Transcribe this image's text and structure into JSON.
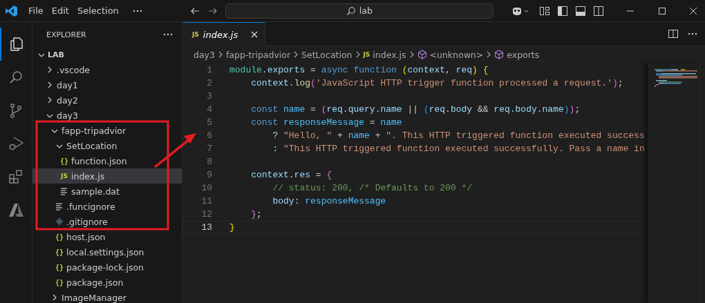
{
  "title_bar": {
    "menu": [
      "File",
      "Edit",
      "Selection"
    ],
    "search": {
      "value": "lab"
    }
  },
  "activity_bar": {
    "items": [
      {
        "kind": "explorer",
        "selected": true
      },
      {
        "kind": "search",
        "selected": false
      },
      {
        "kind": "source-control",
        "selected": false
      },
      {
        "kind": "run-debug",
        "selected": false
      },
      {
        "kind": "extensions",
        "selected": false
      },
      {
        "kind": "azure",
        "selected": false
      }
    ]
  },
  "sidebar": {
    "title": "EXPLORER",
    "root": {
      "label": "LAB",
      "expanded": true,
      "children": [
        {
          "label": ".vscode",
          "kind": "folder",
          "expanded": false,
          "selected": false
        },
        {
          "label": "day1",
          "kind": "folder",
          "expanded": false,
          "selected": false
        },
        {
          "label": "day2",
          "kind": "folder",
          "expanded": false,
          "selected": false
        },
        {
          "label": "day3",
          "kind": "folder",
          "expanded": true,
          "selected": false,
          "children": [
            {
              "label": "fapp-tripadvior",
              "kind": "folder",
              "expanded": true,
              "selected": false,
              "children": [
                {
                  "label": "SetLocation",
                  "kind": "folder",
                  "expanded": true,
                  "selected": false,
                  "children": [
                    {
                      "label": "function.json",
                      "kind": "json",
                      "icon": "{}",
                      "selected": false
                    },
                    {
                      "label": "index.js",
                      "kind": "js",
                      "icon": "JS",
                      "selected": true
                    },
                    {
                      "label": "sample.dat",
                      "kind": "text",
                      "selected": false
                    }
                  ]
                },
                {
                  "label": ".funcignore",
                  "kind": "text",
                  "selected": false
                },
                {
                  "label": ".gitignore",
                  "kind": "git",
                  "selected": false
                },
                {
                  "label": "host.json",
                  "kind": "json",
                  "icon": "{}",
                  "selected": false
                },
                {
                  "label": "local.settings.json",
                  "kind": "json",
                  "icon": "{}",
                  "selected": false
                },
                {
                  "label": "package-lock.json",
                  "kind": "json",
                  "icon": "{}",
                  "selected": false
                },
                {
                  "label": "package.json",
                  "kind": "json",
                  "icon": "{}",
                  "selected": false
                }
              ]
            },
            {
              "label": "ImageManager",
              "kind": "folder",
              "expanded": false,
              "selected": false
            }
          ]
        }
      ]
    }
  },
  "editor": {
    "tabs": [
      {
        "label": "index.js",
        "icon": "JS",
        "selected": true,
        "preview": true
      }
    ],
    "breadcrumbs": [
      {
        "label": "day3",
        "kind": "folder"
      },
      {
        "label": "fapp-tripadvior",
        "kind": "folder"
      },
      {
        "label": "SetLocation",
        "kind": "folder"
      },
      {
        "label": "index.js",
        "kind": "js",
        "icon": "JS"
      },
      {
        "label": "<unknown>",
        "kind": "symbol"
      },
      {
        "label": "exports",
        "kind": "symbol"
      }
    ],
    "lines": [
      {
        "number": "1",
        "current": false,
        "tokens": [
          {
            "text": "module",
            "kind": "ns"
          },
          {
            "text": ".",
            "kind": "p"
          },
          {
            "text": "exports",
            "kind": "var"
          },
          {
            "text": " = ",
            "kind": "p"
          },
          {
            "text": "async ",
            "kind": "kw"
          },
          {
            "text": "function ",
            "kind": "kw"
          },
          {
            "text": "(",
            "kind": "b1"
          },
          {
            "text": "context",
            "kind": "var"
          },
          {
            "text": ", ",
            "kind": "p"
          },
          {
            "text": "req",
            "kind": "var"
          },
          {
            "text": ") ",
            "kind": "b1"
          },
          {
            "text": "{",
            "kind": "b1"
          }
        ]
      },
      {
        "number": "2",
        "current": false,
        "tokens": [
          {
            "text": "    context",
            "kind": "var"
          },
          {
            "text": ".",
            "kind": "p"
          },
          {
            "text": "log",
            "kind": "fn"
          },
          {
            "text": "(",
            "kind": "b2"
          },
          {
            "text": "'JavaScript HTTP trigger function processed a request.'",
            "kind": "str"
          },
          {
            "text": ")",
            "kind": "b2"
          },
          {
            "text": ";",
            "kind": "p"
          }
        ]
      },
      {
        "number": "3",
        "current": false
      },
      {
        "number": "4",
        "current": false,
        "tokens": [
          {
            "text": "    const ",
            "kind": "kw"
          },
          {
            "text": "name",
            "kind": "const"
          },
          {
            "text": " = ",
            "kind": "p"
          },
          {
            "text": "(",
            "kind": "b2"
          },
          {
            "text": "req.query.name",
            "kind": "var"
          },
          {
            "text": " || ",
            "kind": "p"
          },
          {
            "text": "(",
            "kind": "b3"
          },
          {
            "text": "req.body",
            "kind": "var"
          },
          {
            "text": " && ",
            "kind": "p"
          },
          {
            "text": "req.body.name",
            "kind": "var"
          },
          {
            "text": ")",
            "kind": "b3"
          },
          {
            "text": ")",
            "kind": "b2"
          },
          {
            "text": ";",
            "kind": "p"
          }
        ]
      },
      {
        "number": "5",
        "current": false,
        "tokens": [
          {
            "text": "    const ",
            "kind": "kw"
          },
          {
            "text": "responseMessage",
            "kind": "const"
          },
          {
            "text": " = ",
            "kind": "p"
          },
          {
            "text": "name",
            "kind": "const"
          }
        ]
      },
      {
        "number": "6",
        "current": false,
        "tokens": [
          {
            "text": "        ? ",
            "kind": "p"
          },
          {
            "text": "\"Hello, \"",
            "kind": "str"
          },
          {
            "text": " + ",
            "kind": "p"
          },
          {
            "text": "name",
            "kind": "const"
          },
          {
            "text": " + ",
            "kind": "p"
          },
          {
            "text": "\". This HTTP triggered function executed success",
            "kind": "str"
          }
        ]
      },
      {
        "number": "7",
        "current": false,
        "tokens": [
          {
            "text": "        : ",
            "kind": "p"
          },
          {
            "text": "\"This HTTP triggered function executed successfully. Pass a name in",
            "kind": "str"
          }
        ]
      },
      {
        "number": "8",
        "current": false
      },
      {
        "number": "9",
        "current": false,
        "tokens": [
          {
            "text": "    context.res",
            "kind": "var"
          },
          {
            "text": " = ",
            "kind": "p"
          },
          {
            "text": "{",
            "kind": "b2"
          }
        ]
      },
      {
        "number": "10",
        "current": false,
        "tokens": [
          {
            "text": "        // status: 200, /* Defaults to 200 */",
            "kind": "com"
          }
        ]
      },
      {
        "number": "11",
        "current": false,
        "tokens": [
          {
            "text": "        body",
            "kind": "var"
          },
          {
            "text": ": ",
            "kind": "p"
          },
          {
            "text": "responseMessage",
            "kind": "const"
          }
        ]
      },
      {
        "number": "12",
        "current": false,
        "tokens": [
          {
            "text": "    }",
            "kind": "b2"
          },
          {
            "text": ";",
            "kind": "p"
          }
        ]
      },
      {
        "number": "13",
        "current": true,
        "tokens": [
          {
            "text": "}",
            "kind": "b1"
          }
        ]
      }
    ]
  }
}
